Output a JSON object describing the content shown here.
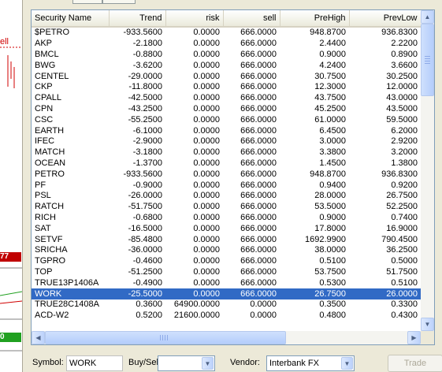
{
  "chart_strip": {
    "label_fragment": "ell",
    "price_tag_red": "77",
    "price_tag_green": "0"
  },
  "table": {
    "columns": [
      "Security Name",
      "Trend",
      "risk",
      "sell",
      "PreHigh",
      "PrevLow"
    ],
    "selected_row": "WORK",
    "rows": [
      [
        "$PETRO",
        "-933.5600",
        "0.0000",
        "666.0000",
        "948.8700",
        "936.8300"
      ],
      [
        "AKP",
        "-2.1800",
        "0.0000",
        "666.0000",
        "2.4400",
        "2.2200"
      ],
      [
        "BMCL",
        "-0.8800",
        "0.0000",
        "666.0000",
        "0.9000",
        "0.8900"
      ],
      [
        "BWG",
        "-3.6200",
        "0.0000",
        "666.0000",
        "4.2400",
        "3.6600"
      ],
      [
        "CENTEL",
        "-29.0000",
        "0.0000",
        "666.0000",
        "30.7500",
        "30.2500"
      ],
      [
        "CKP",
        "-11.8000",
        "0.0000",
        "666.0000",
        "12.3000",
        "12.0000"
      ],
      [
        "CPALL",
        "-42.5000",
        "0.0000",
        "666.0000",
        "43.7500",
        "43.0000"
      ],
      [
        "CPN",
        "-43.2500",
        "0.0000",
        "666.0000",
        "45.2500",
        "43.5000"
      ],
      [
        "CSC",
        "-55.2500",
        "0.0000",
        "666.0000",
        "61.0000",
        "59.5000"
      ],
      [
        "EARTH",
        "-6.1000",
        "0.0000",
        "666.0000",
        "6.4500",
        "6.2000"
      ],
      [
        "IFEC",
        "-2.9000",
        "0.0000",
        "666.0000",
        "3.0000",
        "2.9200"
      ],
      [
        "MATCH",
        "-3.1800",
        "0.0000",
        "666.0000",
        "3.3800",
        "3.2000"
      ],
      [
        "OCEAN",
        "-1.3700",
        "0.0000",
        "666.0000",
        "1.4500",
        "1.3800"
      ],
      [
        "PETRO",
        "-933.5600",
        "0.0000",
        "666.0000",
        "948.8700",
        "936.8300"
      ],
      [
        "PF",
        "-0.9000",
        "0.0000",
        "666.0000",
        "0.9400",
        "0.9200"
      ],
      [
        "PSL",
        "-26.0000",
        "0.0000",
        "666.0000",
        "28.0000",
        "26.7500"
      ],
      [
        "RATCH",
        "-51.7500",
        "0.0000",
        "666.0000",
        "53.5000",
        "52.2500"
      ],
      [
        "RICH",
        "-0.6800",
        "0.0000",
        "666.0000",
        "0.9000",
        "0.7400"
      ],
      [
        "SAT",
        "-16.5000",
        "0.0000",
        "666.0000",
        "17.8000",
        "16.9000"
      ],
      [
        "SETVF",
        "-85.4800",
        "0.0000",
        "666.0000",
        "1692.9900",
        "790.4500"
      ],
      [
        "SRICHA",
        "-36.0000",
        "0.0000",
        "666.0000",
        "38.0000",
        "36.2500"
      ],
      [
        "TGPRO",
        "-0.4600",
        "0.0000",
        "666.0000",
        "0.5100",
        "0.5000"
      ],
      [
        "TOP",
        "-51.2500",
        "0.0000",
        "666.0000",
        "53.7500",
        "51.7500"
      ],
      [
        "TRUE13P1406A",
        "-0.4900",
        "0.0000",
        "666.0000",
        "0.5300",
        "0.5100"
      ],
      [
        "WORK",
        "-25.5000",
        "0.0000",
        "666.0000",
        "26.7500",
        "26.0000"
      ],
      [
        "TRUE28C1408A",
        "0.3600",
        "64900.0000",
        "0.0000",
        "0.3500",
        "0.3300"
      ],
      [
        "ACD-W2",
        "0.5200",
        "21600.0000",
        "0.0000",
        "0.4800",
        "0.4300"
      ],
      [
        "",
        "",
        "",
        "",
        "",
        ""
      ]
    ]
  },
  "bottom": {
    "symbol_label": "Symbol:",
    "symbol_value": "WORK",
    "buysell_label": "Buy/Sell:",
    "buysell_value": "",
    "vendor_label": "Vendor:",
    "vendor_value": "Interbank FX",
    "trade_label": "Trade"
  }
}
